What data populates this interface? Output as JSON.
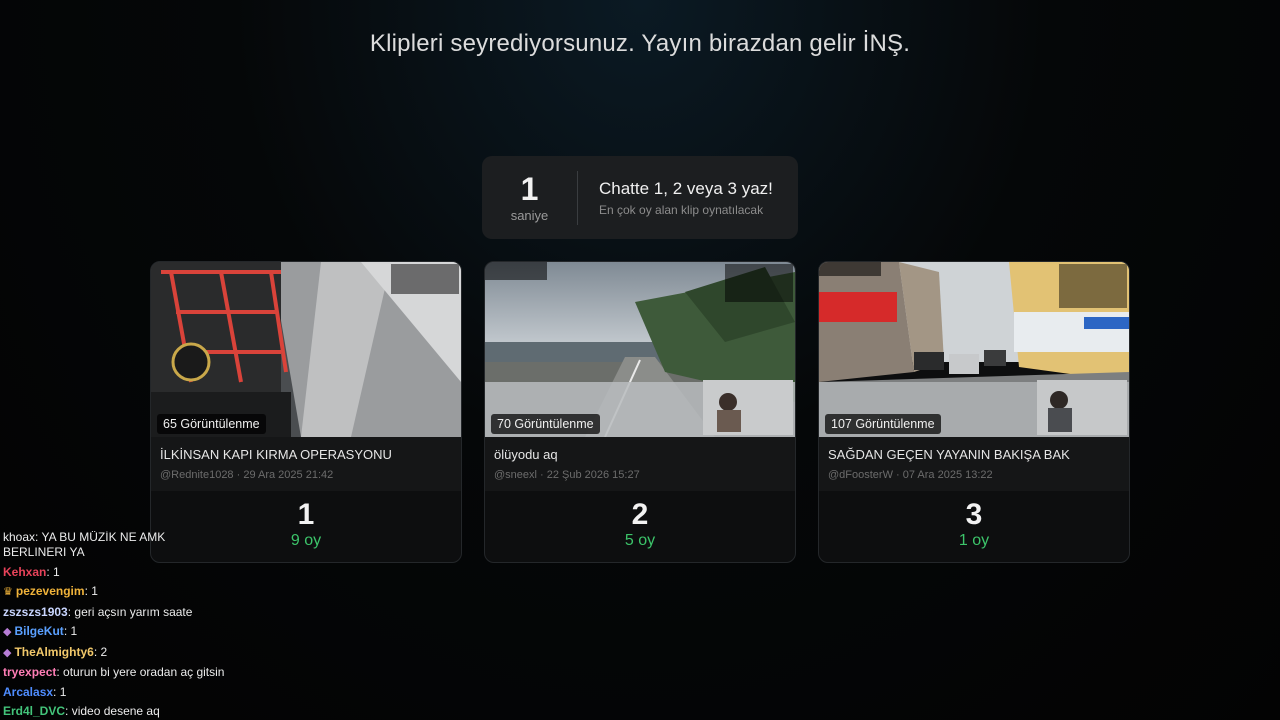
{
  "headline": "Klipleri seyrediyorsunuz. Yayın birazdan gelir İNŞ.",
  "countdown": {
    "number": "1",
    "unit": "saniye",
    "title": "Chatte 1, 2 veya 3 yaz!",
    "subtitle": "En çok oy alan klip oynatılacak"
  },
  "cards": [
    {
      "views": "65 Görüntülenme",
      "title": "İLKİNSAN KAPI KIRMA OPERASYONU",
      "sub": "@Rednite1028 · 29 Ara 2025 21:42",
      "vote_number": "1",
      "vote_count": "9 oy",
      "thumb_scene": "forklift-stairs"
    },
    {
      "views": "70 Görüntülenme",
      "title": "ölüyodu aq",
      "sub": "@sneexl · 22 Şub 2026 15:27",
      "vote_number": "2",
      "vote_count": "5 oy",
      "thumb_scene": "coastal-road-drive"
    },
    {
      "views": "107 Görüntülenme",
      "title": "SAĞDAN GEÇEN YAYANIN BAKIŞA BAK",
      "sub": "@dFoosterW · 07 Ara 2025 13:22",
      "vote_number": "3",
      "vote_count": "1 oy",
      "thumb_scene": "city-street-drive"
    }
  ],
  "chat": {
    "partial_line": "khoax: YA BU MÜZİK NE AMK",
    "messages": [
      {
        "user": "",
        "text": "BERLINERI YA",
        "color": "#ececec",
        "badge": ""
      },
      {
        "user": "Kehxan",
        "text": "1",
        "color": "#e8435a",
        "badge": ""
      },
      {
        "user": "pezevengim",
        "text": "1",
        "color": "#f0b33a",
        "badge": "crown-icon"
      },
      {
        "user": "zszszs1903",
        "text": "geri açsın yarım saate",
        "color": "#c9d6ff",
        "badge": ""
      },
      {
        "user": "BilgeKut",
        "text": "1",
        "color": "#5aa0ff",
        "badge": "badge-icon"
      },
      {
        "user": "TheAlmighty6",
        "text": "2",
        "color": "#f2c96b",
        "badge": "badge-icon"
      },
      {
        "user": "tryexpect",
        "text": "oturun bi yere oradan aç gitsin",
        "color": "#ff7eb6",
        "badge": ""
      },
      {
        "user": "Arcalasx",
        "text": "1",
        "color": "#4f8dff",
        "badge": ""
      },
      {
        "user": "Erd4l_DVC",
        "text": "video desene aq",
        "color": "#43c47a",
        "badge": ""
      }
    ]
  },
  "colors": {
    "vote_green": "#3cc46a",
    "card_bg": "#0d0e0f",
    "panel_bg": "#1c1e20"
  }
}
